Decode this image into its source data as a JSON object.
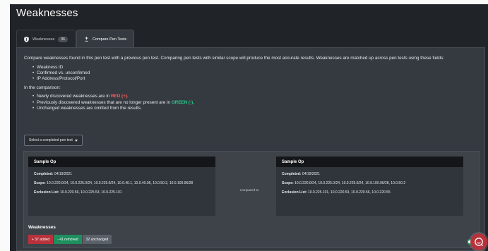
{
  "page": {
    "title": "Weaknesses"
  },
  "tabs": [
    {
      "label": "Weaknesses",
      "badge": "36"
    },
    {
      "label": "Compare Pen Tests",
      "icon": "plus-minus-icon"
    }
  ],
  "compare": {
    "description": "Compare weaknesses found in this pen test with a previous pen test. Comparing pen tests with similar scope will produce the most accurate results. Weaknesses are matched up across pen tests using these fields:",
    "fields": [
      "Weakness ID",
      "Confirmed vs. unconfirmed",
      "IP Address/Protocol/Port"
    ],
    "comparison_heading": "In the comparison:",
    "rules": [
      {
        "pre": "Newly discovered weaknesses are in ",
        "hl": "RED (+)",
        "post": "."
      },
      {
        "pre": "Previously discovered weaknesses that are no longer present are in ",
        "hl": "GREEN (-)",
        "post": "."
      },
      {
        "pre": "Unchanged weaknesses are omitted from the results.",
        "hl": "",
        "post": ""
      }
    ],
    "select_label": "Select a completed pen test",
    "compared_to": "compared to",
    "left": {
      "name": "Sample Op",
      "completed_label": "Completed:",
      "completed": "04/19/2021",
      "scope_label": "Scope:",
      "scope": "10.0.220.0/24, 10.0.225.0/24, 10.0.229.0/24, 10.0.40.1, 10.0.40.95, 10.0.50.2, 10.0.100.96/28",
      "exclusion_label": "Exclusion List:",
      "exclusion": "10.0.220.56, 10.0.225.53, 10.0.225.101"
    },
    "right": {
      "name": "Sample Op",
      "completed_label": "Completed:",
      "completed": "04/19/2021",
      "scope_label": "Scope:",
      "scope": "10.0.220.0/24, 10.0.225.0/24, 10.0.229.0/24, 10.0.100.96/28, 10.0.50.2",
      "exclusion_label": "Exclusion List:",
      "exclusion": "10.0.225.101, 10.0.220.53, 10.0.220.56, 10.0.220.55"
    },
    "weaknesses_title": "Weaknesses",
    "pills": {
      "added": "+ 37 added",
      "removed": "- 41 removed",
      "unchanged": "32 unchanged"
    }
  },
  "colors": {
    "red": "#ff5a5a",
    "green": "#28c98a",
    "accent": "#b8323c"
  }
}
